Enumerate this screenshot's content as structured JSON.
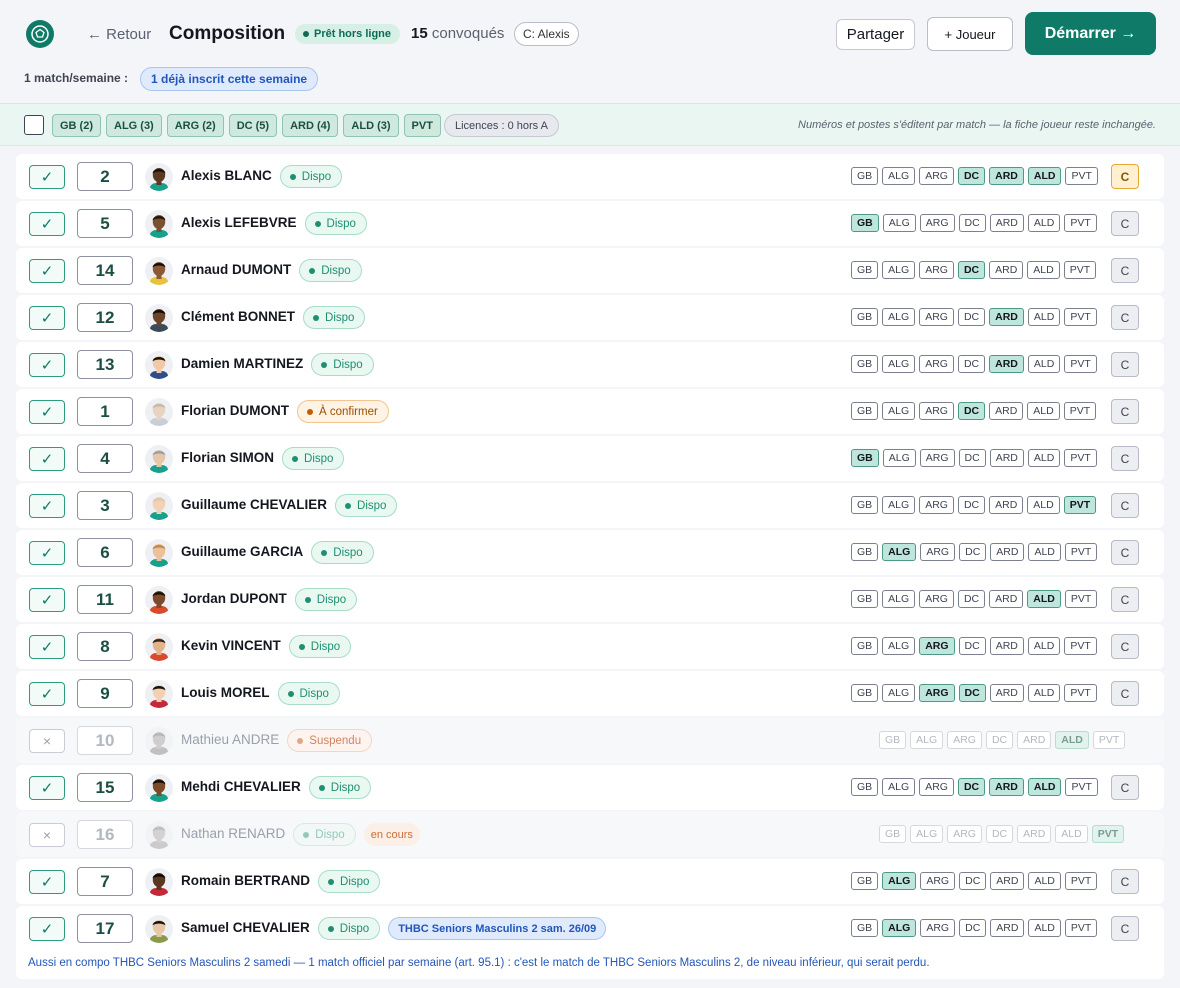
{
  "header": {
    "back_label": "← Retour",
    "title": "Composition",
    "offline_badge": "Prêt hors ligne",
    "convoques_count": "15",
    "convoques_label": "convoqués",
    "captain_pill": "C: Alexis",
    "share_label": "Partager",
    "add_player_label": "+ Joueur",
    "start_label": "Démarrer →",
    "weekly_label": "1 match/semaine :",
    "weekly_badge": "1 déjà inscrit cette semaine"
  },
  "filters": {
    "chips": [
      "GB (2)",
      "ALG (3)",
      "ARG (2)",
      "DC (5)",
      "ARD (4)",
      "ALD (3)",
      "PVT"
    ],
    "licences": "Licences : 0 hors A",
    "hint": "Numéros et postes s'éditent par match — la fiche joueur reste inchangée."
  },
  "positions": [
    "GB",
    "ALG",
    "ARG",
    "DC",
    "ARD",
    "ALD",
    "PVT"
  ],
  "captain_label": "C",
  "players": [
    {
      "number": "2",
      "name": "Alexis BLANC",
      "status": "Dispo",
      "status_type": "dispo",
      "active": true,
      "pos_on": [
        "DC",
        "ARD",
        "ALD"
      ],
      "captain": true,
      "check": "✓",
      "skin": "#5a3a22",
      "shirt": "#17a08a",
      "hair": "#1a1209"
    },
    {
      "number": "5",
      "name": "Alexis LEFEBVRE",
      "status": "Dispo",
      "status_type": "dispo",
      "active": true,
      "pos_on": [
        "GB"
      ],
      "captain": false,
      "check": "✓",
      "skin": "#7a5035",
      "shirt": "#17a08a",
      "hair": "#241609"
    },
    {
      "number": "14",
      "name": "Arnaud DUMONT",
      "status": "Dispo",
      "status_type": "dispo",
      "active": true,
      "pos_on": [
        "DC"
      ],
      "captain": false,
      "check": "✓",
      "skin": "#8a5a36",
      "shirt": "#e8c23a",
      "hair": "#17100a"
    },
    {
      "number": "12",
      "name": "Clément BONNET",
      "status": "Dispo",
      "status_type": "dispo",
      "active": true,
      "pos_on": [
        "ARD"
      ],
      "captain": false,
      "check": "✓",
      "skin": "#6b4429",
      "shirt": "#3b4a5a",
      "hair": "#120c07"
    },
    {
      "number": "13",
      "name": "Damien MARTINEZ",
      "status": "Dispo",
      "status_type": "dispo",
      "active": true,
      "pos_on": [
        "ARD"
      ],
      "captain": false,
      "check": "✓",
      "skin": "#f0c9a6",
      "shirt": "#2d4e8a",
      "hair": "#1a1209"
    },
    {
      "number": "1",
      "name": "Florian DUMONT",
      "status": "À confirmer",
      "status_type": "confirm",
      "active": true,
      "pos_on": [
        "DC"
      ],
      "captain": false,
      "check": "✓",
      "skin": "#e6d3c2",
      "shirt": "#c9ced8",
      "hair": "#c8b8a8"
    },
    {
      "number": "4",
      "name": "Florian SIMON",
      "status": "Dispo",
      "status_type": "dispo",
      "active": true,
      "pos_on": [
        "GB"
      ],
      "captain": false,
      "check": "✓",
      "skin": "#e8c7a8",
      "shirt": "#17a08a",
      "hair": "#9aa0a6"
    },
    {
      "number": "3",
      "name": "Guillaume CHEVALIER",
      "status": "Dispo",
      "status_type": "dispo",
      "active": true,
      "pos_on": [
        "PVT"
      ],
      "captain": false,
      "check": "✓",
      "skin": "#f2d2b6",
      "shirt": "#17a08a",
      "hair": "#e2c8a8"
    },
    {
      "number": "6",
      "name": "Guillaume GARCIA",
      "status": "Dispo",
      "status_type": "dispo",
      "active": true,
      "pos_on": [
        "ALG"
      ],
      "captain": false,
      "check": "✓",
      "skin": "#e9c19a",
      "shirt": "#17a08a",
      "hair": "#c48a44"
    },
    {
      "number": "11",
      "name": "Jordan DUPONT",
      "status": "Dispo",
      "status_type": "dispo",
      "active": true,
      "pos_on": [
        "ALD"
      ],
      "captain": false,
      "check": "✓",
      "skin": "#7a4a2a",
      "shirt": "#d84a2a",
      "hair": "#1a1209"
    },
    {
      "number": "8",
      "name": "Kevin VINCENT",
      "status": "Dispo",
      "status_type": "dispo",
      "active": true,
      "pos_on": [
        "ARG"
      ],
      "captain": false,
      "check": "✓",
      "skin": "#e2b48c",
      "shirt": "#d84a2a",
      "hair": "#3a2414"
    },
    {
      "number": "9",
      "name": "Louis MOREL",
      "status": "Dispo",
      "status_type": "dispo",
      "active": true,
      "pos_on": [
        "ARG",
        "DC"
      ],
      "captain": false,
      "check": "✓",
      "skin": "#f2d0b2",
      "shirt": "#c4293a",
      "hair": "#1a1209"
    },
    {
      "number": "10",
      "name": "Mathieu ANDRE",
      "status": "Suspendu",
      "status_type": "susp",
      "active": false,
      "pos_on": [
        "ALD"
      ],
      "captain": false,
      "check": "×",
      "skin": "#a8a4a4",
      "shirt": "#8a8a8a",
      "hair": "#7a7676"
    },
    {
      "number": "15",
      "name": "Mehdi CHEVALIER",
      "status": "Dispo",
      "status_type": "dispo",
      "active": true,
      "pos_on": [
        "DC",
        "ARD",
        "ALD"
      ],
      "captain": false,
      "check": "✓",
      "skin": "#7a4a2a",
      "shirt": "#17a08a",
      "hair": "#120c07"
    },
    {
      "number": "16",
      "name": "Nathan RENARD",
      "status": "Dispo",
      "status_type": "dispo-faded",
      "extra": "en cours",
      "extra_type": "cours",
      "active": false,
      "pos_on": [
        "PVT"
      ],
      "captain": false,
      "check": "×",
      "skin": "#b0abab",
      "shirt": "#a0a0a0",
      "hair": "#8a8484"
    },
    {
      "number": "7",
      "name": "Romain BERTRAND",
      "status": "Dispo",
      "status_type": "dispo",
      "active": true,
      "pos_on": [
        "ALG"
      ],
      "captain": false,
      "check": "✓",
      "skin": "#5a3620",
      "shirt": "#c4293a",
      "hair": "#100a06"
    },
    {
      "number": "17",
      "name": "Samuel CHEVALIER",
      "status": "Dispo",
      "status_type": "dispo",
      "extra": "THBC Seniors Masculins 2 sam. 26/09",
      "extra_type": "thbc",
      "active": true,
      "pos_on": [
        "ALG"
      ],
      "captain": false,
      "check": "✓",
      "skin": "#e6c6a4",
      "shirt": "#8a9a4a",
      "hair": "#1a1209"
    }
  ],
  "footer_note": "Aussi en compo THBC Seniors Masculins 2 samedi — 1 match officiel par semaine (art. 95.1) : c'est le match de THBC Seniors Masculins 2, de niveau inférieur, qui serait perdu."
}
